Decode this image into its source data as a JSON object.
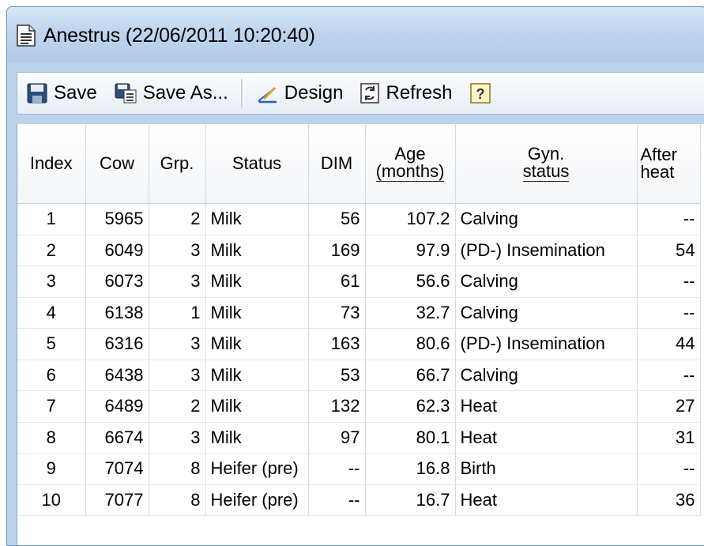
{
  "window": {
    "title": "Anestrus (22/06/2011 10:20:40)",
    "title_icon": "report-icon"
  },
  "toolbar": {
    "save": "Save",
    "save_as": "Save As...",
    "design": "Design",
    "refresh": "Refresh"
  },
  "table": {
    "headers": [
      "Index",
      "Cow",
      "Grp.",
      "Status",
      "DIM",
      "Age",
      "(months)",
      "Gyn.",
      "status",
      "After",
      "heat"
    ],
    "rows": [
      [
        "1",
        "5965",
        "2",
        "Milk",
        "56",
        "107.2",
        "Calving",
        "--"
      ],
      [
        "2",
        "6049",
        "3",
        "Milk",
        "169",
        "97.9",
        "(PD-) Insemination",
        "54"
      ],
      [
        "3",
        "6073",
        "3",
        "Milk",
        "61",
        "56.6",
        "Calving",
        "--"
      ],
      [
        "4",
        "6138",
        "1",
        "Milk",
        "73",
        "32.7",
        "Calving",
        "--"
      ],
      [
        "5",
        "6316",
        "3",
        "Milk",
        "163",
        "80.6",
        "(PD-) Insemination",
        "44"
      ],
      [
        "6",
        "6438",
        "3",
        "Milk",
        "53",
        "66.7",
        "Calving",
        "--"
      ],
      [
        "7",
        "6489",
        "2",
        "Milk",
        "132",
        "62.3",
        "Heat",
        "27"
      ],
      [
        "8",
        "6674",
        "3",
        "Milk",
        "97",
        "80.1",
        "Heat",
        "31"
      ],
      [
        "9",
        "7074",
        "8",
        "Heifer (pre)",
        "--",
        "16.8",
        "Birth",
        "--"
      ],
      [
        "10",
        "7077",
        "8",
        "Heifer (pre)",
        "--",
        "16.7",
        "Heat",
        "36"
      ]
    ]
  }
}
